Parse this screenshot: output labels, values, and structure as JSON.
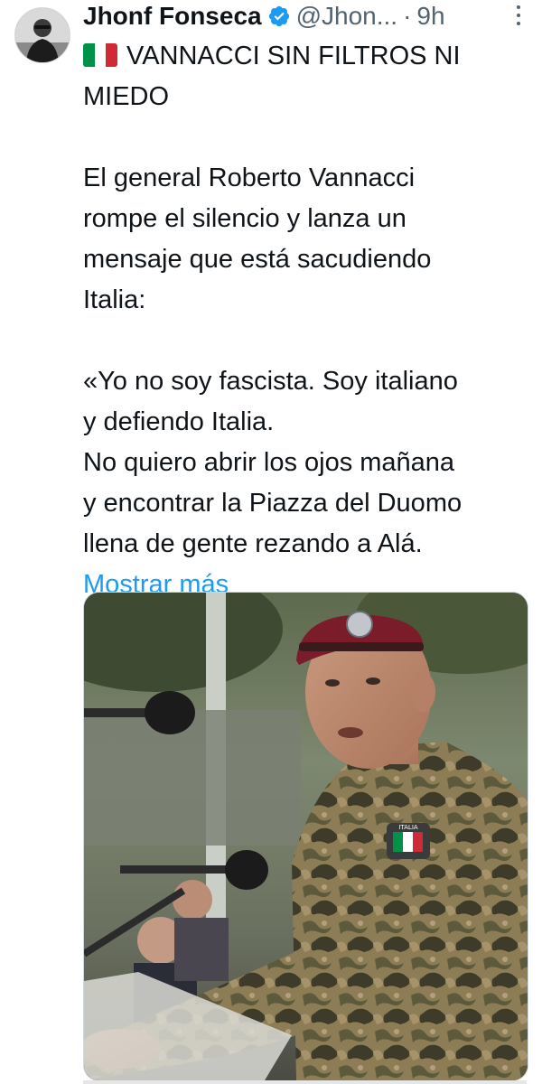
{
  "author": {
    "display_name": "Jhonf Fonseca",
    "handle": "@Jhon...",
    "separator": "·",
    "time": "9h",
    "verified": true,
    "avatar": "author-avatar"
  },
  "tweet": {
    "headline_flag": "italy-flag",
    "lines": {
      "l1": "VANNACCI SIN FILTROS NI",
      "l2": "MIEDO",
      "l3": "El general Roberto Vannacci",
      "l4": "rompe el silencio y lanza un",
      "l5": "mensaje que está sacudiendo",
      "l6": "Italia:",
      "l7": "«Yo no soy fascista. Soy italiano",
      "l8": "y defiendo Italia.",
      "l9": "No quiero abrir los ojos mañana",
      "l10": "y encontrar la Piazza del Duomo",
      "l11": "llena de gente rezando a Alá."
    },
    "show_more": "Mostrar más"
  },
  "media": {
    "kind": "photo",
    "badge_text": "ITALIA"
  },
  "icons": {
    "verified": "verified-badge-icon",
    "more": "more-options-icon"
  },
  "colors": {
    "link": "#1d9bf0",
    "verified": "#1d9bf0",
    "muted": "#536471",
    "text": "#0f1419"
  }
}
